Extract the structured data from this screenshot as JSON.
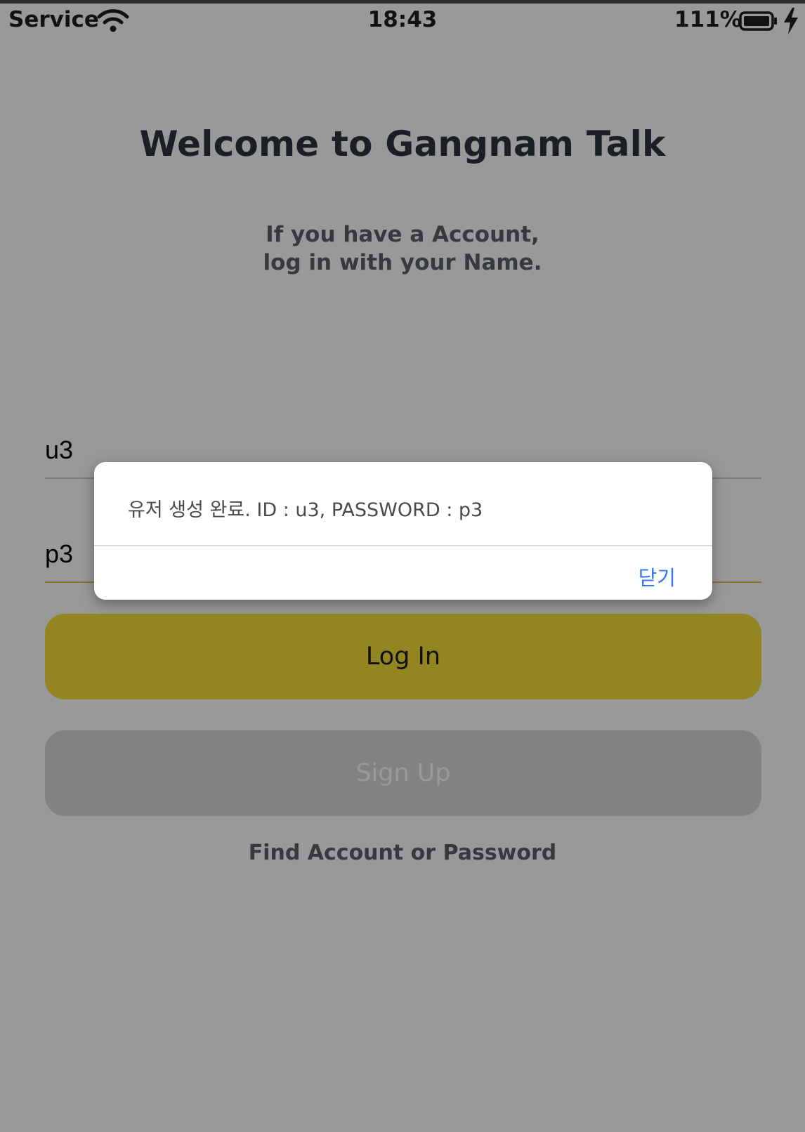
{
  "status_bar": {
    "carrier": "Service",
    "time": "18:43",
    "battery_percent": "111%"
  },
  "login_screen": {
    "title": "Welcome to Gangnam Talk",
    "subtitle_line1": "If you have a Account,",
    "subtitle_line2": "log in with your Name.",
    "username_value": "u3",
    "password_value": "p3",
    "login_label": "Log In",
    "signup_label": "Sign Up",
    "find_link_label": "Find Account or Password"
  },
  "dialog": {
    "message": "유저 생성 완료. ID : u3, PASSWORD : p3",
    "close_label": "닫기"
  },
  "colors": {
    "login_button": "#f5e03a",
    "signup_button": "#d9d9d9",
    "dialog_action": "#3478f6",
    "focused_underline": "#e0c24a"
  }
}
